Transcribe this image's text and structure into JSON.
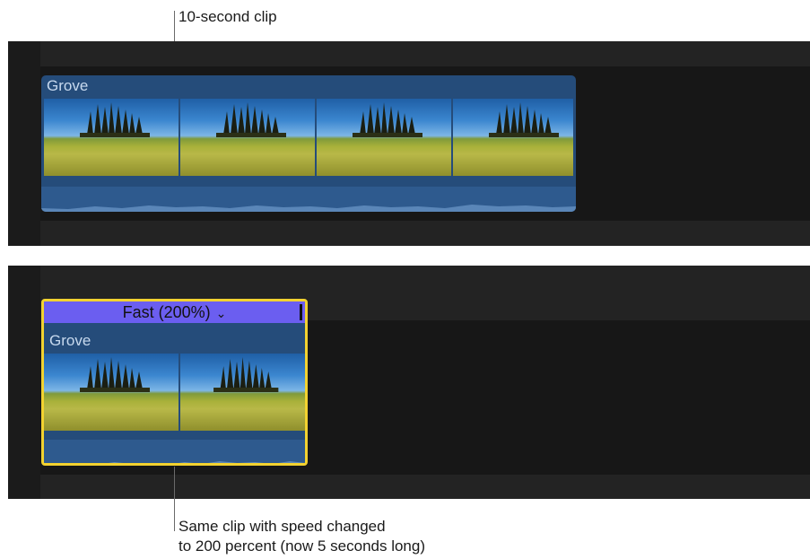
{
  "callouts": {
    "top": "10-second clip",
    "bottom_line1": "Same clip with speed changed",
    "bottom_line2": "to 200 percent (now 5 seconds long)"
  },
  "clip_original": {
    "name": "Grove",
    "thumbnail_count": 4
  },
  "clip_retimed": {
    "name": "Grove",
    "speed_label": "Fast (200%)",
    "thumbnail_count": 2,
    "speed_percent": 200
  },
  "colors": {
    "clip_blue": "#254c7a",
    "retime_bar": "#6b5ef0",
    "selection": "#f2d230",
    "timeline_bg": "#232323"
  },
  "icons": {
    "speed_menu": "chevron-down-icon",
    "retime_handle": "retime-handle-icon"
  }
}
